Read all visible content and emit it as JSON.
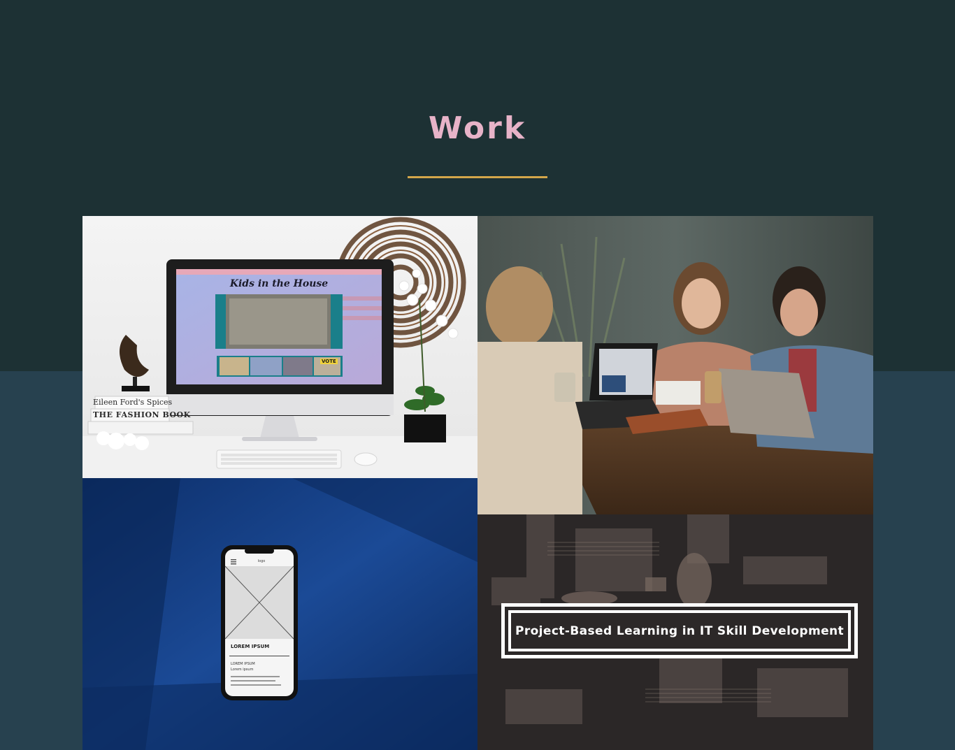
{
  "section": {
    "title": "Work"
  },
  "colors": {
    "top_background": "#1d3134",
    "bottom_background": "#27414f",
    "title": "#e7b3c8",
    "title_rule": "#d3a64a",
    "card_border": "#ffffff"
  },
  "portfolio": {
    "desktop_mockup": {
      "screen_heading": "Kids in the House",
      "vote_label": "VOTE",
      "book_top": "Eileen Ford's Spices",
      "book_bottom": "THE FASHION BOOK"
    },
    "phone_mockup": {
      "logo": "logo",
      "heading": "LOREM IPSUM",
      "line_1": "LOREM IPSUM",
      "line_2": "Lorem ipsum"
    },
    "project_card": {
      "title": "Project-Based Learning in IT Skill Development"
    }
  }
}
